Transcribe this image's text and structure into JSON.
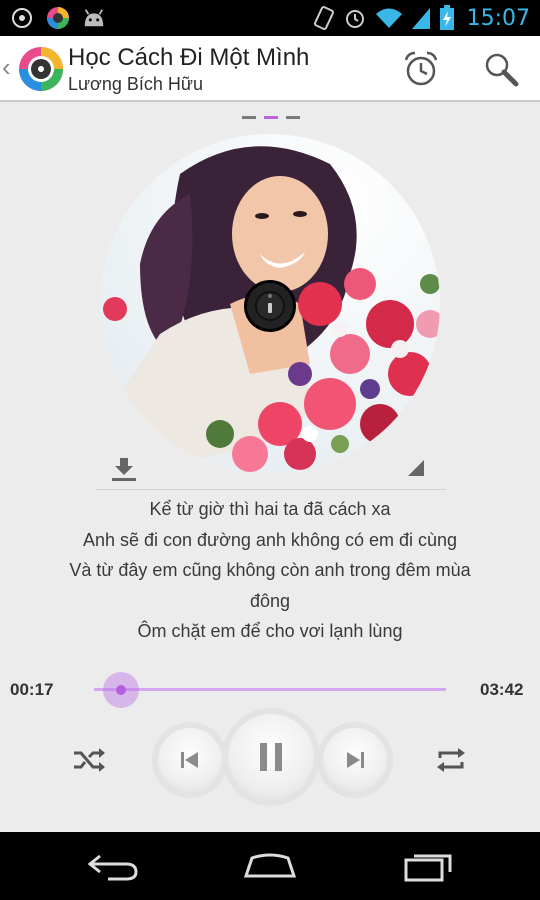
{
  "status_bar": {
    "time": "15:07",
    "icons": [
      "notification-app-icon",
      "music-app-icon",
      "android-icon",
      "rotate-icon",
      "alarm-icon",
      "wifi-icon",
      "signal-icon",
      "battery-icon"
    ]
  },
  "header": {
    "title": "Học Cách Đi Một Mình",
    "artist": "Lương Bích Hữu",
    "actions": [
      "alarm-clock-icon",
      "search-icon"
    ]
  },
  "pager": {
    "pages": 3,
    "active_index": 1
  },
  "lyrics": [
    "Kể từ giờ thì hai ta đã cách xa",
    "Anh sẽ đi con đường anh không có em đi cùng",
    "Và từ đây em cũng không còn anh trong đêm mùa",
    "đông",
    "Ôm chặt em để cho vơi lạnh lùng"
  ],
  "player": {
    "elapsed": "00:17",
    "total": "03:42",
    "progress": 0.077,
    "state": "playing"
  },
  "colors": {
    "accent": "#b766e0",
    "status_time": "#39b8e8",
    "background": "#ececec"
  },
  "nav": [
    "back-icon",
    "home-icon",
    "recent-apps-icon"
  ]
}
